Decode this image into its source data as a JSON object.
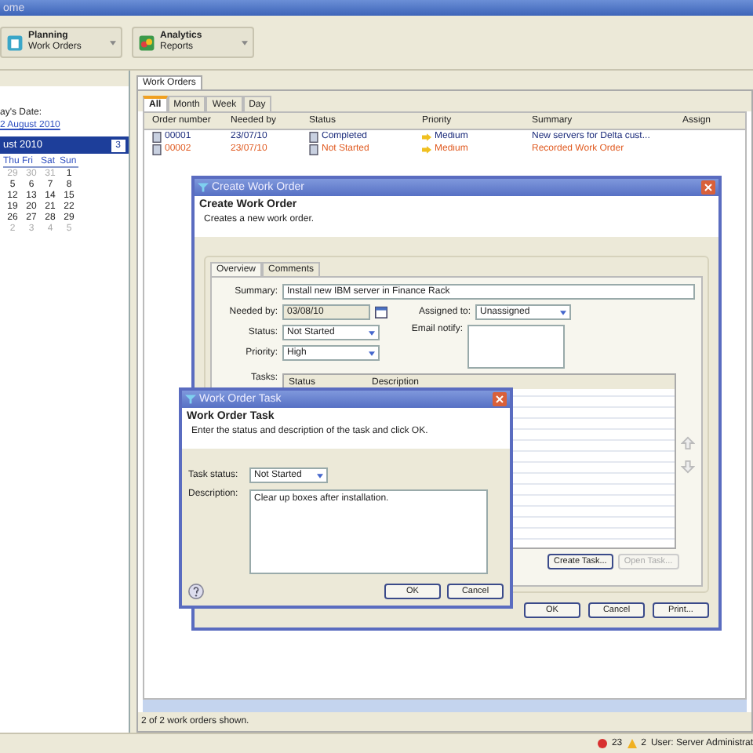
{
  "window": {
    "title": "ome"
  },
  "toolbar": [
    {
      "title": "Planning",
      "subtitle": "Work Orders"
    },
    {
      "title": "Analytics",
      "subtitle": "Reports"
    }
  ],
  "left_panel": {
    "date_label": "ay's Date:",
    "date_link": "2 August 2010",
    "month": "ust 2010",
    "next": "3",
    "weekdays": [
      "Thu",
      "Fri",
      "Sat",
      "Sun"
    ],
    "weeks": [
      [
        {
          "day": "29",
          "other_month": true
        },
        {
          "day": "30",
          "other_month": true
        },
        {
          "day": "31",
          "other_month": true
        },
        {
          "day": "1",
          "other_month": false
        }
      ],
      [
        {
          "day": "5",
          "other_month": false
        },
        {
          "day": "6",
          "other_month": false
        },
        {
          "day": "7",
          "other_month": false
        },
        {
          "day": "8",
          "other_month": false
        }
      ],
      [
        {
          "day": "12",
          "other_month": false
        },
        {
          "day": "13",
          "other_month": false
        },
        {
          "day": "14",
          "other_month": false
        },
        {
          "day": "15",
          "other_month": false
        }
      ],
      [
        {
          "day": "19",
          "other_month": false
        },
        {
          "day": "20",
          "other_month": false
        },
        {
          "day": "21",
          "other_month": false
        },
        {
          "day": "22",
          "other_month": false
        }
      ],
      [
        {
          "day": "26",
          "other_month": false
        },
        {
          "day": "27",
          "other_month": false
        },
        {
          "day": "28",
          "other_month": false
        },
        {
          "day": "29",
          "other_month": false
        }
      ],
      [
        {
          "day": "2",
          "other_month": true
        },
        {
          "day": "3",
          "other_month": true
        },
        {
          "day": "4",
          "other_month": true
        },
        {
          "day": "5",
          "other_month": true
        }
      ]
    ]
  },
  "main": {
    "tab": "Work Orders",
    "view_tabs": [
      {
        "label": "All",
        "selected": true
      },
      {
        "label": "Month",
        "selected": false
      },
      {
        "label": "Week",
        "selected": false
      },
      {
        "label": "Day",
        "selected": false
      }
    ],
    "table": {
      "columns": [
        "Order number",
        "Needed by",
        "Status",
        "Priority",
        "Summary",
        "Assign"
      ],
      "rows": [
        {
          "color": "#1a2a7a",
          "cells": [
            "00001",
            "23/07/10",
            "Completed",
            "Medium",
            "New servers for Delta cust..."
          ]
        },
        {
          "color": "#e05a20",
          "cells": [
            "00002",
            "23/07/10",
            "Not Started",
            "Medium",
            "Recorded Work Order"
          ]
        }
      ]
    },
    "status_text": "2 of 2 work orders shown."
  },
  "status_bar": {
    "errors": "23",
    "warnings": "2",
    "user": "User: Server Administrat"
  },
  "create_dialog": {
    "title": "Create Work Order",
    "heading": "Create Work Order",
    "description": "Creates a new work order.",
    "tabs": [
      {
        "label": "Overview",
        "selected": true
      },
      {
        "label": "Comments",
        "selected": false
      }
    ],
    "summary_label": "Summary:",
    "summary": "Install new IBM server in Finance Rack",
    "needed_label": "Needed by:",
    "needed": "03/08/10",
    "assigned_label": "Assigned to:",
    "assigned": "Unassigned",
    "status_label": "Status:",
    "status": "Not Started",
    "email_label": "Email notify:",
    "priority_label": "Priority:",
    "priority": "High",
    "tasks_label": "Tasks:",
    "task_columns": [
      "Status",
      "Description"
    ],
    "task_buttons": [
      {
        "label": "Create Task...",
        "disabled": false
      },
      {
        "label": "Open Task...",
        "disabled": true
      }
    ],
    "buttons": [
      "OK",
      "Cancel",
      "Print..."
    ]
  },
  "task_dialog": {
    "title": "Work Order Task",
    "heading": "Work Order Task",
    "description": "Enter the status and description of the task and click OK.",
    "status_label": "Task status:",
    "status": "Not Started",
    "description_label": "Description:",
    "description_value": "Clear up boxes after installation.",
    "buttons": [
      "OK",
      "Cancel"
    ]
  }
}
